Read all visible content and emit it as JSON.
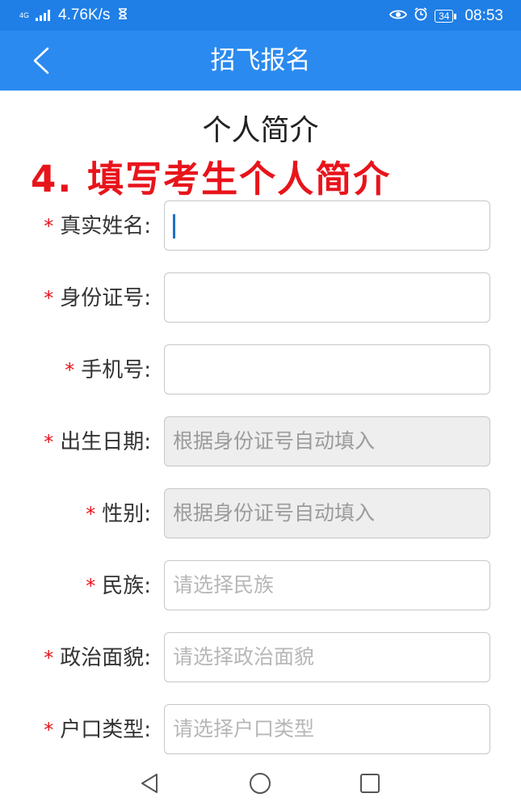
{
  "status_bar": {
    "network_type": "4G",
    "speed": "4.76K/s",
    "battery": "34",
    "time": "08:53",
    "icons": [
      "signal-icon",
      "hourglass-icon",
      "eye-icon",
      "alarm-icon",
      "battery-icon"
    ]
  },
  "nav": {
    "title": "招飞报名",
    "back_icon": "chevron-left-icon"
  },
  "page": {
    "title": "个人简介",
    "annotation": "4. 填写考生个人简介"
  },
  "form": {
    "required_marker": "*",
    "fields": [
      {
        "label": "真实姓名:",
        "value": "",
        "placeholder": "",
        "focused": true,
        "disabled": false
      },
      {
        "label": "身份证号:",
        "value": "",
        "placeholder": "",
        "disabled": false
      },
      {
        "label": "手机号:",
        "value": "",
        "placeholder": "",
        "disabled": false
      },
      {
        "label": "出生日期:",
        "value": "",
        "placeholder": "根据身份证号自动填入",
        "disabled": true
      },
      {
        "label": "性别:",
        "value": "",
        "placeholder": "根据身份证号自动填入",
        "disabled": true
      },
      {
        "label": "民族:",
        "value": "",
        "placeholder": "请选择民族",
        "disabled": false
      },
      {
        "label": "政治面貌:",
        "value": "",
        "placeholder": "请选择政治面貌",
        "disabled": false
      },
      {
        "label": "户口类型:",
        "value": "",
        "placeholder": "请选择户口类型",
        "disabled": false
      }
    ]
  },
  "system_nav": {
    "icons": [
      "back-triangle-icon",
      "home-circle-icon",
      "recents-square-icon"
    ]
  },
  "colors": {
    "status_bar": "#1f7fe6",
    "nav_bar": "#2a8af0",
    "required": "#e8141b",
    "annotation": "#e8141b",
    "disabled_field": "#eeeeee"
  }
}
